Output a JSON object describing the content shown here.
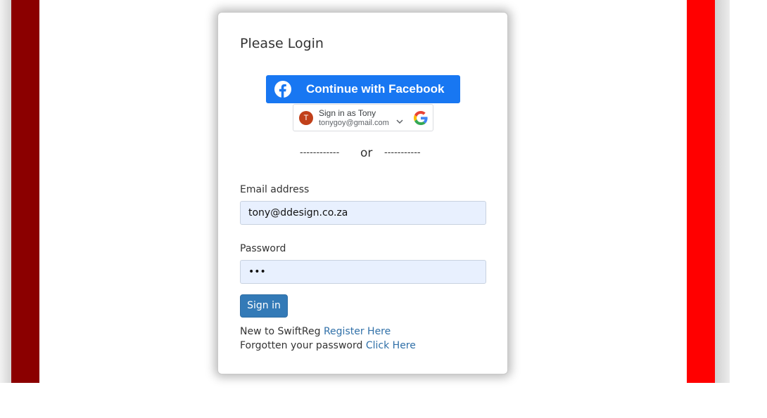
{
  "login": {
    "title": "Please Login",
    "facebook_button": "Continue with Facebook",
    "google": {
      "avatar_letter": "T",
      "name": "Sign in as Tony",
      "email": "tonygoy@gmail.com"
    },
    "divider": {
      "left": "------------",
      "word": "or",
      "right": "-----------"
    },
    "email_label": "Email address",
    "email_value": "tony@ddesign.co.za",
    "password_label": "Password",
    "password_value": "•••",
    "signin_button": "Sign in",
    "register_text": "New to SwiftReg",
    "register_link": "Register Here",
    "forgot_text": "Forgotten your password",
    "forgot_link": "Click Here"
  },
  "colors": {
    "left_bar": "#8b0000",
    "right_bar": "#ff0000",
    "facebook": "#1877f2",
    "signin": "#337ab7",
    "input_bg": "#e8f0fe",
    "link": "#3070a8"
  },
  "icons": [
    "facebook-logo-icon",
    "google-logo-icon",
    "chevron-down-icon"
  ]
}
